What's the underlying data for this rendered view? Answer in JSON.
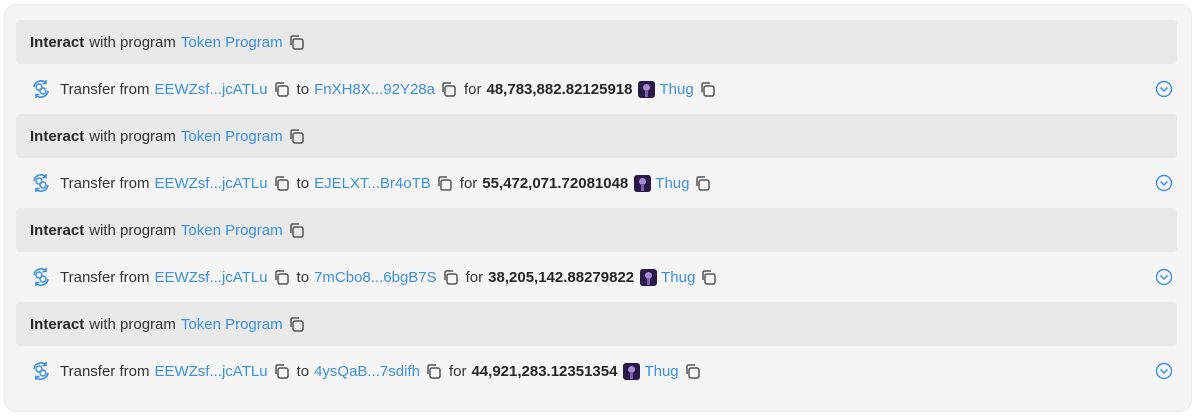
{
  "colors": {
    "link": "#3d8fe0",
    "panel_bg": "#f5f5f5",
    "interact_bg": "#e9e9e9"
  },
  "entries": [
    {
      "interact": {
        "bold": "Interact",
        "text": "with program",
        "program": "Token Program"
      },
      "transfer": {
        "label": "Transfer from",
        "from": "EEWZsf...jcATLu",
        "to_word": "to",
        "to": "FnXH8X...92Y28a",
        "for_word": "for",
        "amount": "48,783,882.82125918",
        "token": "Thug"
      }
    },
    {
      "interact": {
        "bold": "Interact",
        "text": "with program",
        "program": "Token Program"
      },
      "transfer": {
        "label": "Transfer from",
        "from": "EEWZsf...jcATLu",
        "to_word": "to",
        "to": "EJELXT...Br4oTB",
        "for_word": "for",
        "amount": "55,472,071.72081048",
        "token": "Thug"
      }
    },
    {
      "interact": {
        "bold": "Interact",
        "text": "with program",
        "program": "Token Program"
      },
      "transfer": {
        "label": "Transfer from",
        "from": "EEWZsf...jcATLu",
        "to_word": "to",
        "to": "7mCbo8...6bgB7S",
        "for_word": "for",
        "amount": "38,205,142.88279822",
        "token": "Thug"
      }
    },
    {
      "interact": {
        "bold": "Interact",
        "text": "with program",
        "program": "Token Program"
      },
      "transfer": {
        "label": "Transfer from",
        "from": "EEWZsf...jcATLu",
        "to_word": "to",
        "to": "4ysQaB...7sdifh",
        "for_word": "for",
        "amount": "44,921,283.12351354",
        "token": "Thug"
      }
    }
  ]
}
